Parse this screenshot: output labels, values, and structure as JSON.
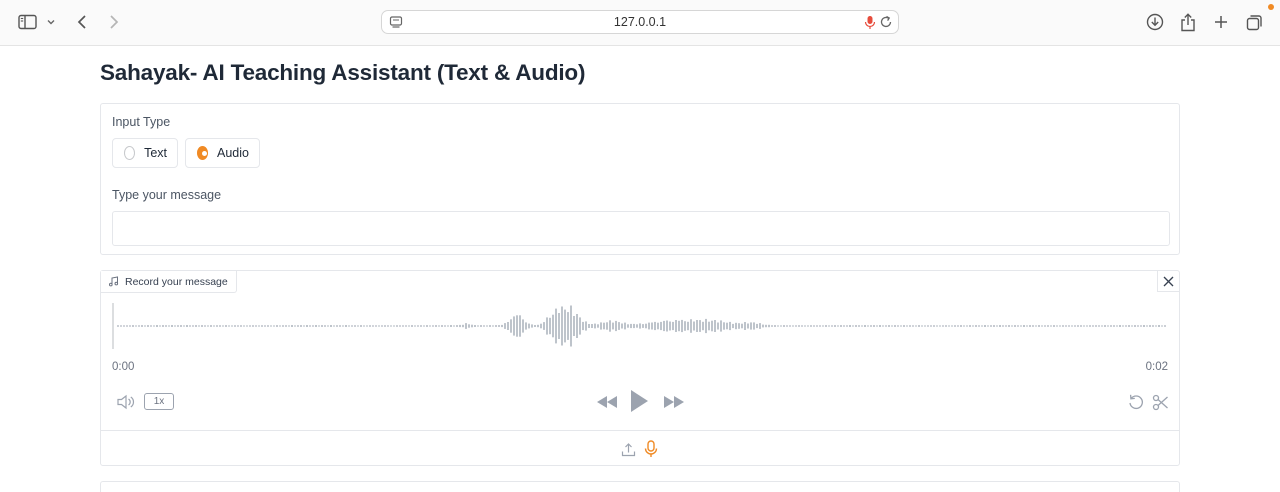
{
  "browser": {
    "url": "127.0.0.1",
    "accent": "#f08a24"
  },
  "page": {
    "title": "Sahayak- AI Teaching Assistant (Text & Audio)"
  },
  "input_type": {
    "label": "Input Type",
    "options": [
      {
        "label": "Text",
        "checked": false
      },
      {
        "label": "Audio",
        "checked": true
      }
    ]
  },
  "message": {
    "label": "Type your message",
    "value": ""
  },
  "audio": {
    "label": "Record your message",
    "time_start": "0:00",
    "time_end": "0:02",
    "speed": "1x",
    "waveform_color": "#9ca3af",
    "icons": [
      "music-icon",
      "close-icon",
      "volume-icon",
      "rewind-icon",
      "play-icon",
      "fast-forward-icon",
      "undo-icon",
      "scissors-icon",
      "upload-icon",
      "microphone-icon"
    ]
  }
}
